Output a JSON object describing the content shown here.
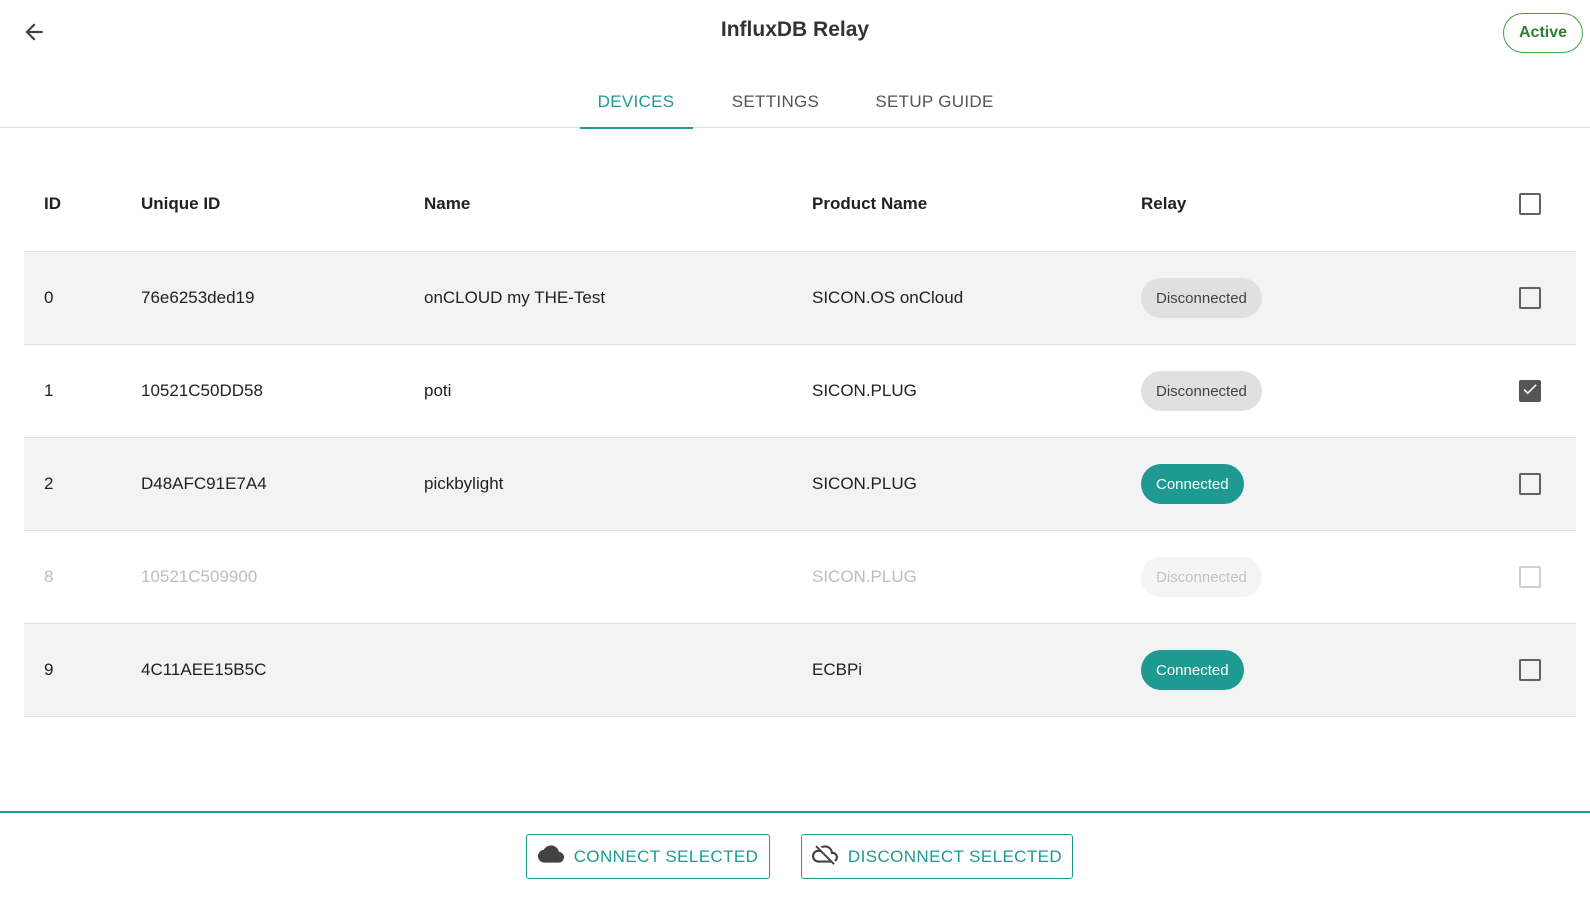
{
  "header": {
    "title": "InfluxDB Relay",
    "status": "Active",
    "back_icon": "arrow-left-icon"
  },
  "tabs": [
    {
      "label": "DEVICES",
      "active": true
    },
    {
      "label": "SETTINGS",
      "active": false
    },
    {
      "label": "SETUP GUIDE",
      "active": false
    }
  ],
  "table": {
    "columns": [
      "ID",
      "Unique ID",
      "Name",
      "Product Name",
      "Relay"
    ],
    "rows": [
      {
        "id": "0",
        "unique_id": "76e6253ded19",
        "name": "onCLOUD my THE-Test",
        "product": "SICON.OS onCloud",
        "relay": "Disconnected",
        "checked": false,
        "disabled": false
      },
      {
        "id": "1",
        "unique_id": "10521C50DD58",
        "name": "poti",
        "product": "SICON.PLUG",
        "relay": "Disconnected",
        "checked": true,
        "disabled": false
      },
      {
        "id": "2",
        "unique_id": "D48AFC91E7A4",
        "name": "pickbylight",
        "product": "SICON.PLUG",
        "relay": "Connected",
        "checked": false,
        "disabled": false
      },
      {
        "id": "8",
        "unique_id": "10521C509900",
        "name": "",
        "product": "SICON.PLUG",
        "relay": "Disconnected",
        "checked": false,
        "disabled": true
      },
      {
        "id": "9",
        "unique_id": "4C11AEE15B5C",
        "name": "",
        "product": "ECBPi",
        "relay": "Connected",
        "checked": false,
        "disabled": false
      }
    ]
  },
  "footer": {
    "connect_label": "CONNECT SELECTED",
    "connect_icon": "cloud-icon",
    "disconnect_label": "DISCONNECT SELECTED",
    "disconnect_icon": "cloud-off-icon"
  },
  "colors": {
    "accent": "#1f9a92",
    "active_status": "#2e7d32",
    "chip_connected": "#1f9a92",
    "chip_disconnected": "#e0e0e0",
    "row_shade": "#f3f3f3"
  }
}
